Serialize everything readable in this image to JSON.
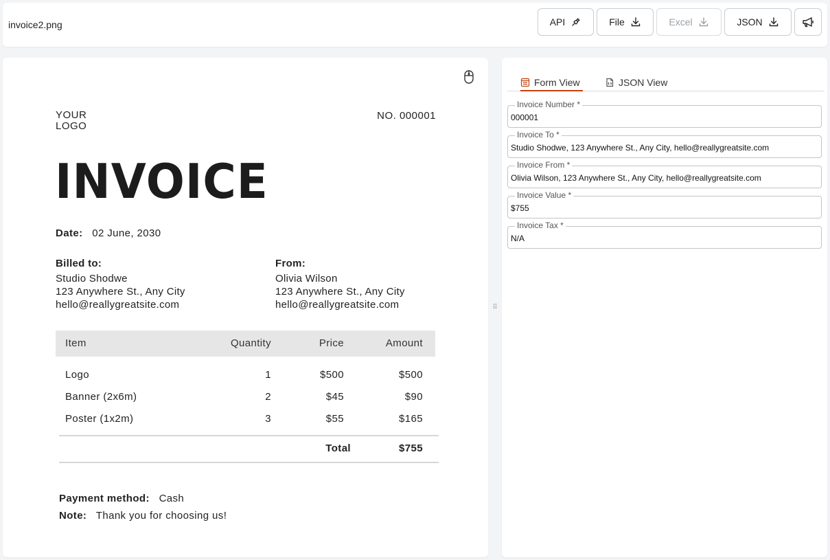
{
  "toolbar": {
    "filename": "invoice2.png",
    "buttons": {
      "api": "API",
      "file": "File",
      "excel": "Excel",
      "json": "JSON"
    }
  },
  "invoice": {
    "logo_line1": "YOUR",
    "logo_line2": "LOGO",
    "number": "NO. 000001",
    "title": "INVOICE",
    "date_label": "Date:",
    "date_value": "02 June, 2030",
    "billed_to": {
      "heading": "Billed to:",
      "name": "Studio Shodwe",
      "address": "123 Anywhere St., Any City",
      "email": "hello@reallygreatsite.com"
    },
    "from": {
      "heading": "From:",
      "name": "Olivia Wilson",
      "address": "123 Anywhere St., Any City",
      "email": "hello@reallygreatsite.com"
    },
    "table": {
      "headers": [
        "Item",
        "Quantity",
        "Price",
        "Amount"
      ],
      "rows": [
        [
          "Logo",
          "1",
          "$500",
          "$500"
        ],
        [
          "Banner (2x6m)",
          "2",
          "$45",
          "$90"
        ],
        [
          "Poster (1x2m)",
          "3",
          "$55",
          "$165"
        ]
      ],
      "total_label": "Total",
      "total_value": "$755"
    },
    "payment_label": "Payment method:",
    "payment_value": "Cash",
    "note_label": "Note:",
    "note_value": "Thank you for choosing us!"
  },
  "tabs": [
    {
      "label": "Form View",
      "active": true
    },
    {
      "label": "JSON View",
      "active": false
    }
  ],
  "form": {
    "fields": [
      {
        "label": "Invoice Number *",
        "value": "000001"
      },
      {
        "label": "Invoice To *",
        "value": "Studio Shodwe, 123 Anywhere St., Any City, hello@reallygreatsite.com"
      },
      {
        "label": "Invoice From *",
        "value": "Olivia Wilson, 123 Anywhere St., Any City, hello@reallygreatsite.com"
      },
      {
        "label": "Invoice Value *",
        "value": "$755"
      },
      {
        "label": "Invoice Tax *",
        "value": "N/A"
      }
    ]
  },
  "colors": {
    "accent": "#c2410c",
    "table_header_bg": "#e6e6e6"
  },
  "icons": {
    "api": "api-plug-icon",
    "download": "download-icon",
    "megaphone": "megaphone-icon",
    "mouse": "mouse-icon",
    "form_view": "form-view-icon",
    "json_view": "json-file-icon",
    "resize": "resize-grip-icon"
  }
}
